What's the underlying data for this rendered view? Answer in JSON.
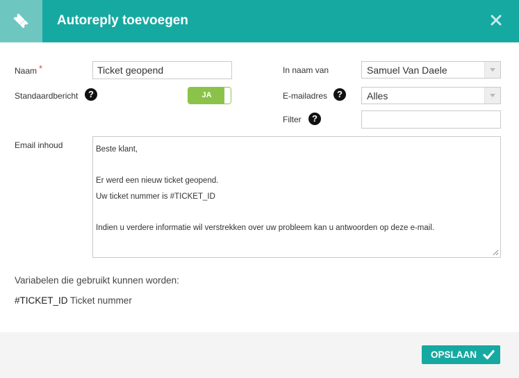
{
  "dialog": {
    "title": "Autoreply toevoegen",
    "header_icon": "ticket-icon",
    "close_icon": "close-icon"
  },
  "form": {
    "name_label": "Naam",
    "required_mark": "*",
    "name_value": "Ticket geopend",
    "default_label": "Standaardbericht",
    "default_toggle_label": "JA",
    "default_toggle_on": true,
    "on_behalf_label": "In naam van",
    "on_behalf_value": "Samuel Van Daele",
    "email_label": "E-mailadres",
    "email_value": "Alles",
    "filter_label": "Filter",
    "filter_value": "",
    "content_label": "Email inhoud",
    "help_glyph": "?",
    "content_lines": [
      "Beste klant,",
      "",
      "Er werd een nieuw ticket geopend.",
      "Uw ticket nummer is #TICKET_ID",
      "",
      "Indien u verdere informatie wil verstrekken over uw probleem kan u antwoorden op deze e-mail."
    ]
  },
  "variables": {
    "label": "Variabelen die gebruikt kunnen worden:",
    "items": [
      {
        "key": "#TICKET_ID",
        "desc": "Ticket nummer"
      }
    ]
  },
  "footer": {
    "save_label": "OPSLAAN"
  },
  "colors": {
    "accent": "#16a9a1",
    "accent_light": "#6ec6c1",
    "toggle_on": "#8bc34a",
    "required": "#e04343"
  }
}
